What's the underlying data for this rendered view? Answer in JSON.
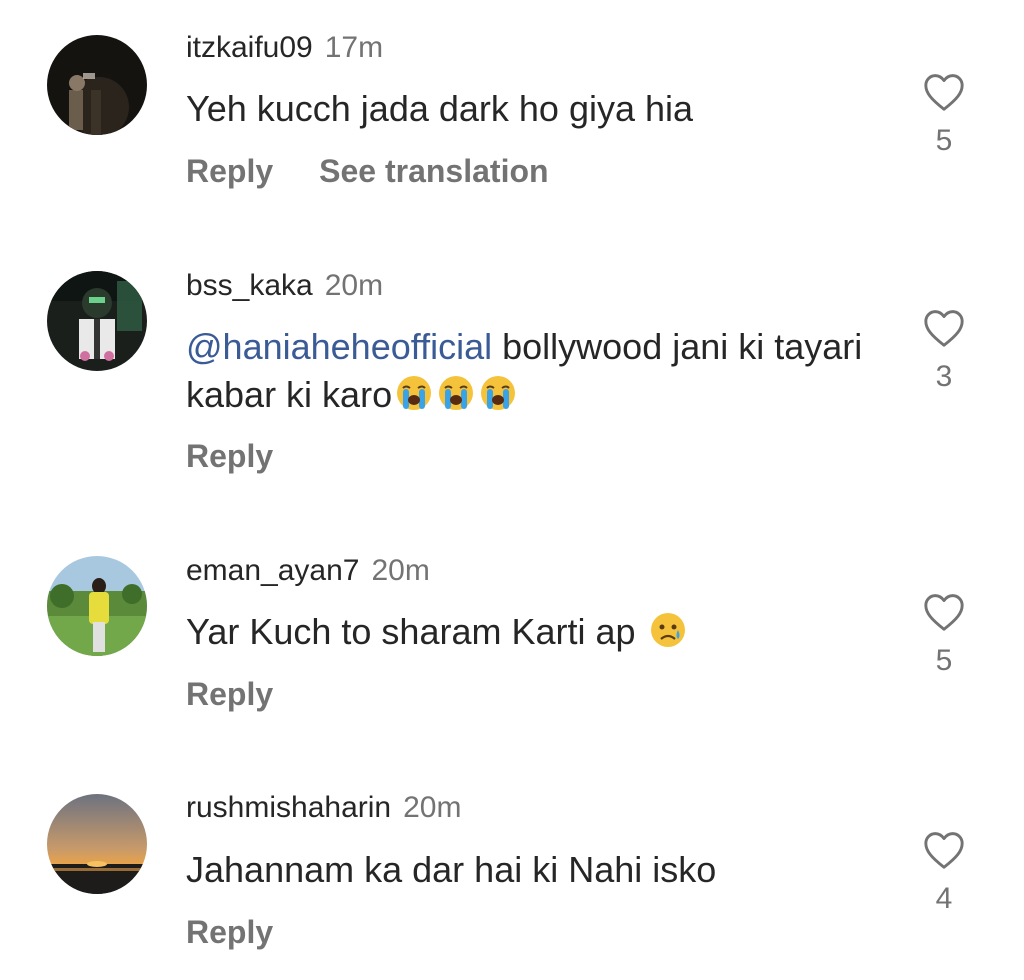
{
  "comments": [
    {
      "username": "itzkaifu09",
      "time": "17m",
      "text": "Yeh kucch jada dark ho giya hia",
      "reply_label": "Reply",
      "translate_label": "See translation",
      "likes": "5",
      "avatar": "avatar-dark-night-photo"
    },
    {
      "username": "bss_kaka",
      "time": "20m",
      "mention": "@haniaheheofficial",
      "text": " bollywood jani ki tayari kabar ki karo",
      "emoji": "loudly-crying-face-icon",
      "emoji_count": 3,
      "reply_label": "Reply",
      "likes": "3",
      "avatar": "avatar-masked-character"
    },
    {
      "username": "eman_ayan7",
      "time": "20m",
      "text": "Yar Kuch to sharam Karti ap ",
      "emoji": "sad-tear-face-icon",
      "reply_label": "Reply",
      "likes": "5",
      "avatar": "avatar-girl-in-field"
    },
    {
      "username": "rushmishaharin",
      "time": "20m",
      "text": "Jahannam ka dar hai ki Nahi isko",
      "reply_label": "Reply",
      "likes": "4",
      "avatar": "avatar-sunset"
    }
  ],
  "colors": {
    "text": "#262626",
    "secondary": "#737373",
    "mention": "#3a5b96"
  }
}
